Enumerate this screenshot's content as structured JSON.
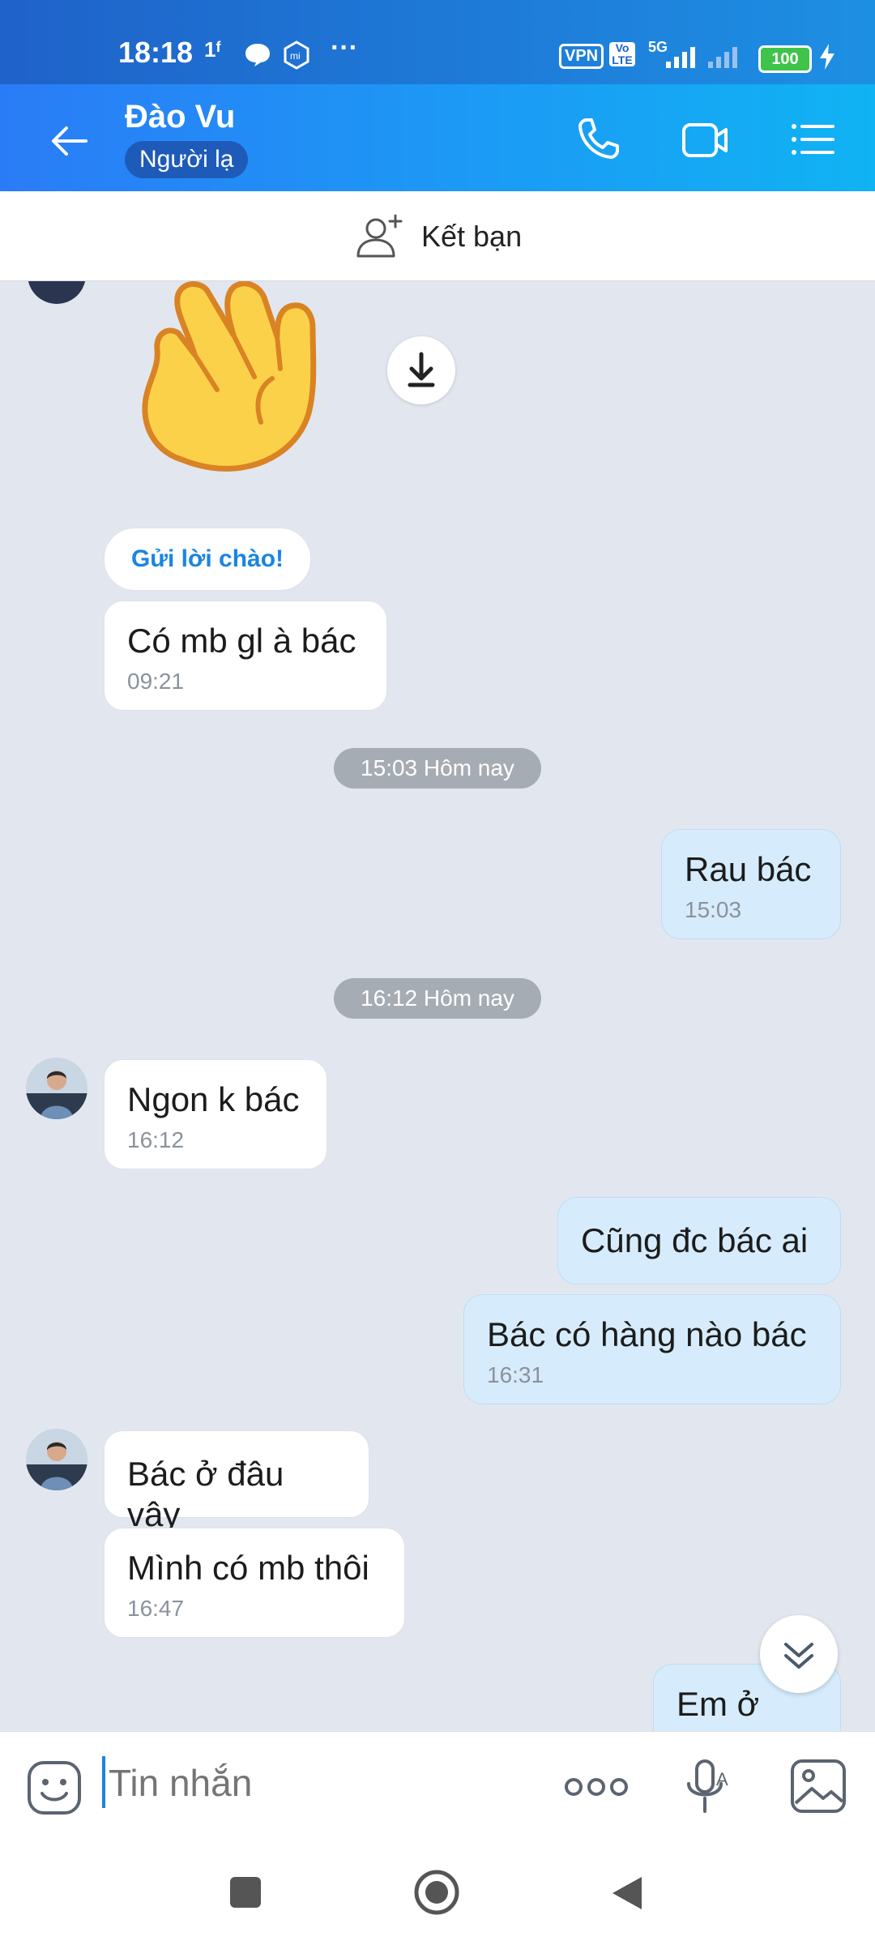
{
  "status_bar": {
    "time": "18:18",
    "indicator": "1ᶠ",
    "vpn": "VPN",
    "volte": "Vo LTE",
    "network": "5G",
    "battery": "100"
  },
  "header": {
    "contact_name": "Đào Vu",
    "badge": "Người lạ"
  },
  "add_friend": {
    "label": "Kết bạn"
  },
  "chat": {
    "greeting_button": "Gửi lời chào!",
    "messages": [
      {
        "text": "Có mb gl à bác",
        "time": "09:21"
      },
      {
        "text": "Rau bác",
        "time": "15:03"
      },
      {
        "text": "Ngon k bác",
        "time": "16:12"
      },
      {
        "text": "Cũng đc bác ai"
      },
      {
        "text": "Bác có hàng nào bác",
        "time": "16:31"
      },
      {
        "text": "Bác ở đâu vậy"
      },
      {
        "text": "Mình có mb thôi",
        "time": "16:47"
      },
      {
        "text": "Em ở HN"
      }
    ],
    "dates": [
      "15:03 Hôm nay",
      "16:12 Hôm nay"
    ]
  },
  "input": {
    "placeholder": "Tin nhắn"
  },
  "colors": {
    "header_gradient_start": "#2a7cf6",
    "header_gradient_end": "#10b3f4",
    "chat_background": "#e2e7ef",
    "outgoing_bubble": "#d6ecfc",
    "incoming_bubble": "#ffffff"
  },
  "icons": [
    "back-arrow-icon",
    "phone-icon",
    "video-call-icon",
    "menu-list-icon",
    "add-friend-icon",
    "download-icon",
    "scroll-down-icon",
    "sticker-icon",
    "more-icon",
    "voice-icon",
    "image-icon"
  ]
}
